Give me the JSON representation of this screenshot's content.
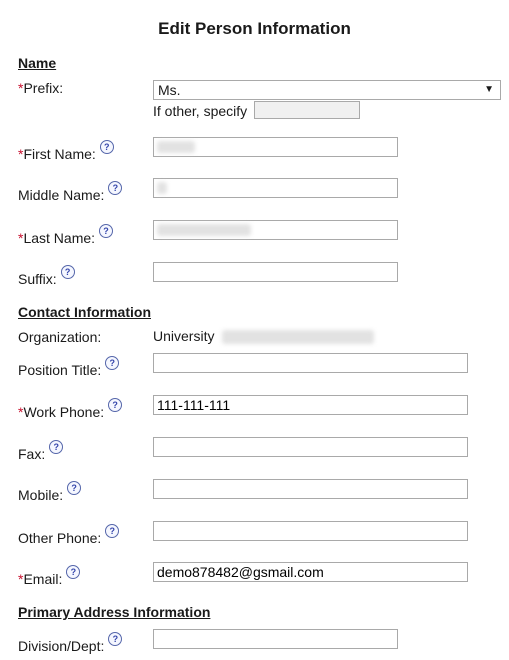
{
  "page": {
    "title": "Edit Person Information"
  },
  "sections": {
    "name": "Name",
    "contact": "Contact Information",
    "address": "Primary Address Information"
  },
  "fields": {
    "prefix": {
      "label": "Prefix:",
      "required": "*",
      "value": "Ms.",
      "other_label": "If other, specify"
    },
    "first_name": {
      "label": "First Name:",
      "required": "*"
    },
    "middle_name": {
      "label": "Middle Name:"
    },
    "last_name": {
      "label": "Last Name:",
      "required": "*"
    },
    "suffix": {
      "label": "Suffix:"
    },
    "organization": {
      "label": "Organization:",
      "value": "University"
    },
    "position_title": {
      "label": "Position Title:"
    },
    "work_phone": {
      "label": "Work Phone:",
      "required": "*",
      "value": "111-111-111"
    },
    "fax": {
      "label": "Fax:"
    },
    "mobile": {
      "label": "Mobile:"
    },
    "other_phone": {
      "label": "Other Phone:"
    },
    "email": {
      "label": "Email:",
      "required": "*",
      "value": "demo878482@gsmail.com"
    },
    "division": {
      "label": "Division/Dept:"
    }
  },
  "icons": {
    "help": "question-circle-icon",
    "help_glyph": "?"
  }
}
